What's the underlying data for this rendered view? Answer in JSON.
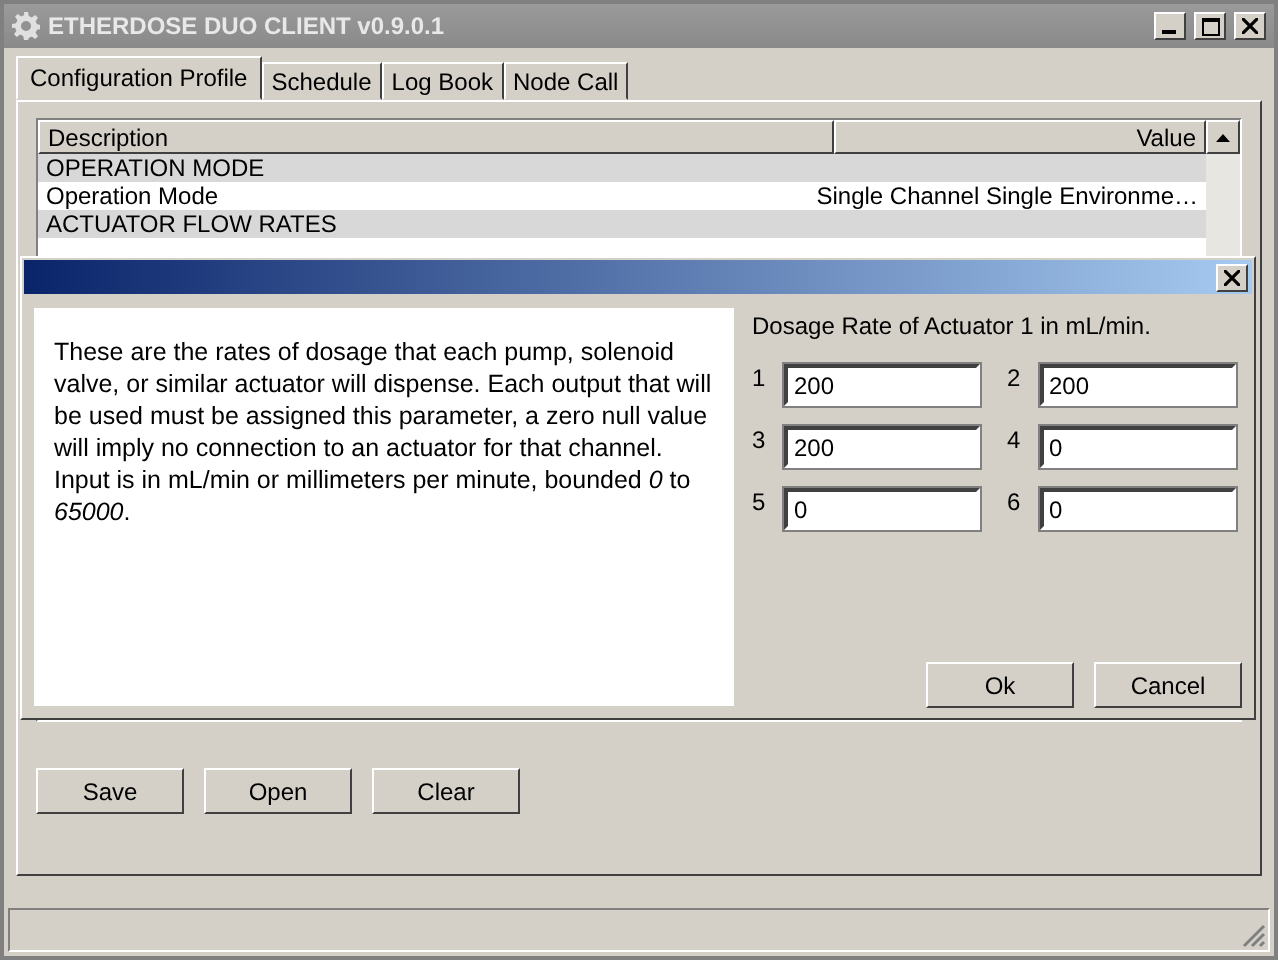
{
  "window": {
    "title": "ETHERDOSE DUO CLIENT v0.9.0.1"
  },
  "tabs": [
    {
      "label": "Configuration Profile",
      "selected": true
    },
    {
      "label": "Schedule",
      "selected": false
    },
    {
      "label": "Log Book",
      "selected": false
    },
    {
      "label": "Node Call",
      "selected": false
    }
  ],
  "table": {
    "columns": [
      "Description",
      "Value"
    ],
    "rows": [
      {
        "kind": "group",
        "description": "OPERATION MODE"
      },
      {
        "kind": "item",
        "description": "Operation Mode",
        "value": "Single Channel Single Environme…"
      },
      {
        "kind": "group",
        "description": "ACTUATOR FLOW RATES"
      }
    ]
  },
  "buttons": [
    "Save",
    "Open",
    "Clear"
  ],
  "dialog": {
    "help": "These are the rates of dosage that each pump, solenoid valve, or similar actuator will dispense. Each output that will be used must be assigned this parameter, a zero null value will imply no connection to an actuator for that channel. Input is in mL/min or millimeters per minute, bounded *0* to *65000*.",
    "prompt": "Dosage Rate of Actuator 1 in mL/min.",
    "fields": [
      {
        "label": "1",
        "value": "200"
      },
      {
        "label": "2",
        "value": "200"
      },
      {
        "label": "3",
        "value": "200"
      },
      {
        "label": "4",
        "value": "0"
      },
      {
        "label": "5",
        "value": "0"
      },
      {
        "label": "6",
        "value": "0"
      }
    ],
    "buttons": [
      "Ok",
      "Cancel"
    ]
  }
}
